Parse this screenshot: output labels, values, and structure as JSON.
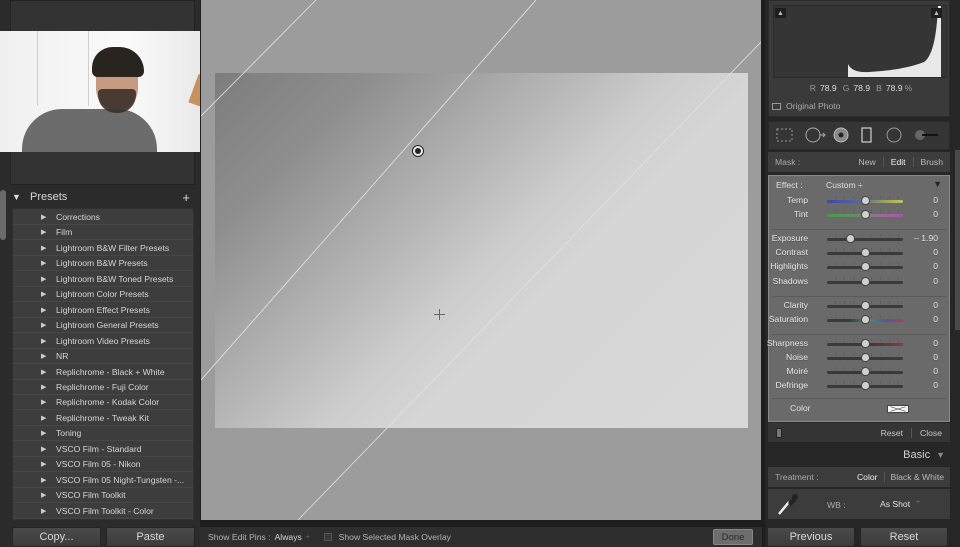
{
  "left_panel": {
    "presets": {
      "title": "Presets",
      "add_icon": "+",
      "collapse_icon": "▼",
      "items": [
        {
          "label": "Corrections"
        },
        {
          "label": "Film"
        },
        {
          "label": "Lightroom B&W Filter Presets"
        },
        {
          "label": "Lightroom B&W Presets"
        },
        {
          "label": "Lightroom B&W Toned Presets"
        },
        {
          "label": "Lightroom Color Presets"
        },
        {
          "label": "Lightroom Effect Presets"
        },
        {
          "label": "Lightroom General Presets"
        },
        {
          "label": "Lightroom Video Presets"
        },
        {
          "label": "NR"
        },
        {
          "label": "Replichrome - Black + White"
        },
        {
          "label": "Replichrome - Fuji Color"
        },
        {
          "label": "Replichrome - Kodak Color"
        },
        {
          "label": "Replichrome - Tweak Kit"
        },
        {
          "label": "Toning"
        },
        {
          "label": "VSCO Film - Standard"
        },
        {
          "label": "VSCO Film 05 - Nikon"
        },
        {
          "label": "VSCO Film 05 Night-Tungsten -..."
        },
        {
          "label": "VSCO Film Toolkit"
        },
        {
          "label": "VSCO Film Toolkit - Color"
        }
      ],
      "expand_icon": "▶"
    },
    "buttons": {
      "copy": "Copy...",
      "paste": "Paste"
    }
  },
  "toolbar": {
    "show_edit_pins_label": "Show Edit Pins :",
    "show_edit_pins_value": "Always",
    "spinner_icon": "÷",
    "mask_overlay_label": "Show Selected Mask Overlay",
    "mask_overlay_checked": false,
    "done_label": "Done"
  },
  "right_panel": {
    "histogram": {
      "r_label": "R",
      "r_value": "78.9",
      "g_label": "G",
      "g_value": "78.9",
      "b_label": "B",
      "b_value": "78.9",
      "unit": "%",
      "original_photo_label": "Original Photo",
      "clip_icon": "▲"
    },
    "mask": {
      "label": "Mask :",
      "options": [
        "New",
        "Edit",
        "Brush"
      ],
      "active": "Edit"
    },
    "effect": {
      "label": "Effect :",
      "value": "Custom ÷",
      "menu_icon": "▼"
    },
    "sliders": [
      {
        "name": "Temp",
        "value": "0",
        "position": 0.5,
        "track": "temp"
      },
      {
        "name": "Tint",
        "value": "0",
        "position": 0.5,
        "track": "tint"
      },
      {
        "name": "Exposure",
        "value": "– 1.90",
        "position": 0.31,
        "track": "plain"
      },
      {
        "name": "Contrast",
        "value": "0",
        "position": 0.5,
        "track": "plain"
      },
      {
        "name": "Highlights",
        "value": "0",
        "position": 0.5,
        "track": "plain"
      },
      {
        "name": "Shadows",
        "value": "0",
        "position": 0.5,
        "track": "plain"
      },
      {
        "name": "Clarity",
        "value": "0",
        "position": 0.5,
        "track": "plain"
      },
      {
        "name": "Saturation",
        "value": "0",
        "position": 0.5,
        "track": "sat"
      },
      {
        "name": "Sharpness",
        "value": "0",
        "position": 0.5,
        "track": "sharp"
      },
      {
        "name": "Noise",
        "value": "0",
        "position": 0.5,
        "track": "plain"
      },
      {
        "name": "Moiré",
        "value": "0",
        "position": 0.5,
        "track": "plain"
      },
      {
        "name": "Defringe",
        "value": "0",
        "position": 0.5,
        "track": "plain"
      }
    ],
    "color": {
      "label": "Color"
    },
    "footer": {
      "reset": "Reset",
      "close": "Close"
    },
    "basic": {
      "title": "Basic",
      "collapse_icon": "▼",
      "treatment_label": "Treatment :",
      "treatment_options": [
        "Color",
        "Black & White"
      ],
      "treatment_active": "Color",
      "wb_label": "WB :",
      "wb_value": "As Shot",
      "wb_spinner": "÷"
    },
    "buttons": {
      "previous": "Previous",
      "reset": "Reset"
    }
  }
}
